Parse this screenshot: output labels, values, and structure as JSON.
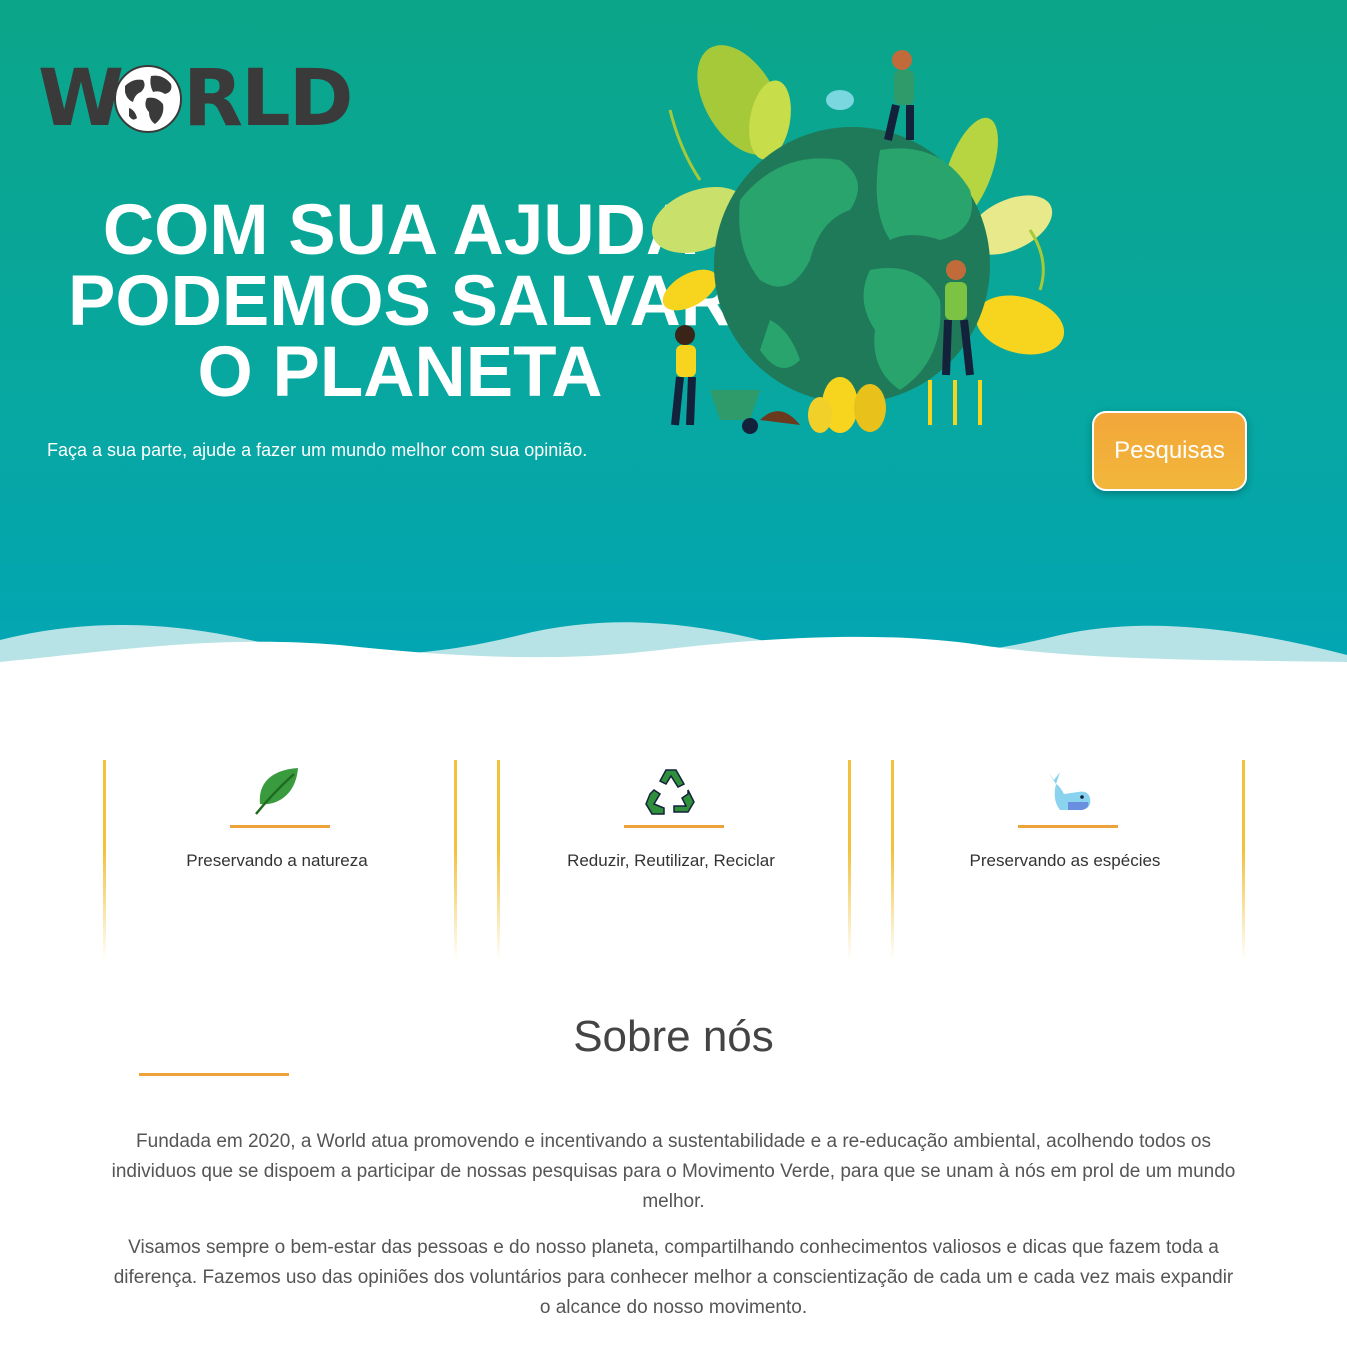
{
  "brand": {
    "logo_text_left": "W",
    "logo_text_right": "RLD",
    "logo_full": "WORLD"
  },
  "hero": {
    "headline_lines": [
      "COM SUA AJUDA",
      "PODEMOS SALVAR",
      "O PLANETA"
    ],
    "subtitle": "Faça a sua parte, ajude a fazer um mundo melhor com sua opinião.",
    "button_label": "Pesquisas",
    "illustration": "people-planting-around-earth-globe"
  },
  "features": [
    {
      "icon": "leaf-icon",
      "label": "Preservando a natureza"
    },
    {
      "icon": "recycle-icon",
      "label": "Reduzir, Reutilizar, Reciclar"
    },
    {
      "icon": "whale-icon",
      "label": "Preservando as espécies"
    }
  ],
  "about": {
    "title": "Sobre nós",
    "paragraphs": [
      "Fundada em 2020, a World atua promovendo e incentivando a sustentabilidade e a re-educação ambiental, acolhendo todos os individuos que se dispoem a participar de nossas pesquisas para o Movimento Verde, para que se unam à nós em prol de um mundo melhor.",
      "Visamos sempre o bem-estar das pessoas e do nosso planeta, compartilhando conhecimentos valiosos e dicas que fazem toda a diferença. Fazemos uso das opiniões dos voluntários para conhecer melhor a conscientização de cada um e cada vez mais expandir o alcance do nosso movimento."
    ]
  },
  "colors": {
    "hero_gradient_top": "#0ba589",
    "hero_gradient_bottom": "#02a6b4",
    "accent_orange": "#eda23a",
    "accent_yellow": "#f2c23c",
    "button": "#f3a63a"
  }
}
